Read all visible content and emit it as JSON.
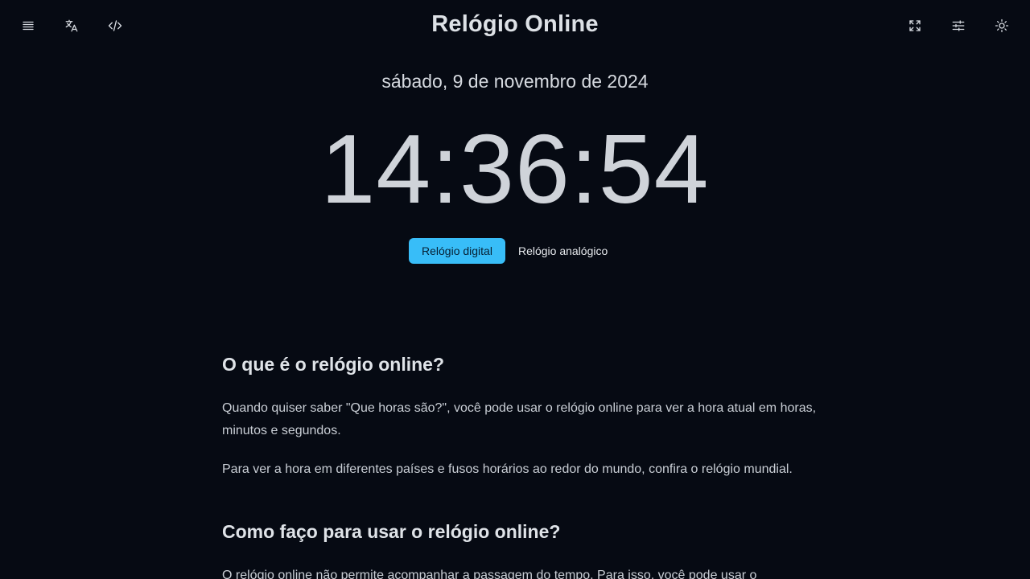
{
  "header": {
    "title": "Relógio Online",
    "icons": {
      "menu": "menu-icon",
      "language": "translate-icon",
      "embed": "code-icon",
      "fullscreen": "fullscreen-icon",
      "settings": "sliders-icon",
      "theme": "sun-icon"
    }
  },
  "clock": {
    "date": "sábado, 9 de novembro de 2024",
    "time": "14:36:54"
  },
  "modes": {
    "digital": "Relógio digital",
    "analog": "Relógio analógico",
    "active": "digital"
  },
  "article": {
    "section1": {
      "heading": "O que é o relógio online?",
      "paragraph1": "Quando quiser saber \"Que horas são?\", você pode usar o relógio online para ver a hora atual em horas, minutos e segundos.",
      "paragraph2": "Para ver a hora em diferentes países e fusos horários ao redor do mundo, confira o relógio mundial."
    },
    "section2": {
      "heading": "Como faço para usar o relógio online?",
      "paragraph1": "O relógio online não permite acompanhar a passagem do tempo. Para isso, você pode usar o"
    }
  },
  "colors": {
    "background": "#060a13",
    "accent": "#38bdf8",
    "text": "#d9dde3"
  }
}
